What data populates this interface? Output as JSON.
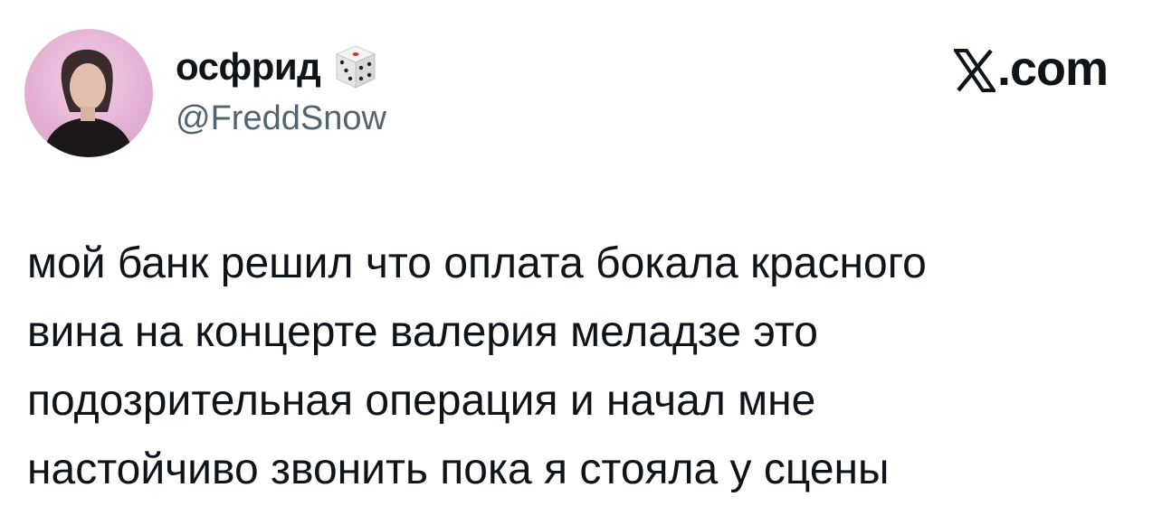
{
  "author": {
    "display_name": "осфрид",
    "name_emoji": "dice-icon",
    "handle": "@FreddSnow",
    "avatar": "profile-photo-avatar"
  },
  "brand": {
    "logo": "x-logo-icon",
    "domain": ".com"
  },
  "tweet": {
    "lines": [
      "мой банк решил что оплата бокала красного",
      "вина на концерте валерия меладзе это",
      "подозрительная операция и начал мне",
      "настойчиво звонить пока я стояла у сцены"
    ]
  },
  "colors": {
    "text_primary": "#0f1419",
    "text_secondary": "#536471",
    "background": "#ffffff",
    "avatar_bg": "#e9b6d8"
  }
}
